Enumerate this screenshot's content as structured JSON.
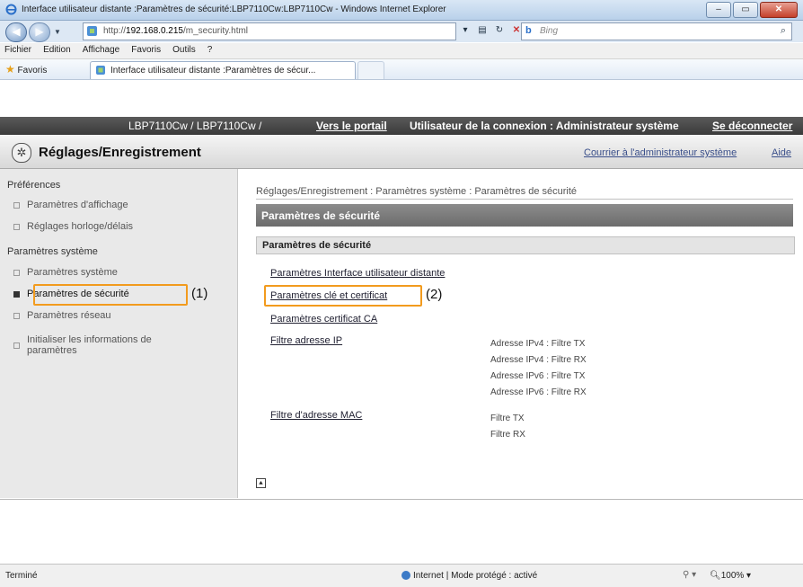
{
  "window": {
    "title": "Interface utilisateur distante :Paramètres de sécurité:LBP7110Cw:LBP7110Cw - Windows Internet Explorer",
    "minimize": "–",
    "maximize": "▭",
    "close": "✕"
  },
  "address_bar": {
    "url_prefix": "http://",
    "url_host": "192.168.0.215",
    "url_path": "/m_security.html",
    "search_placeholder": "Bing",
    "back": "◀",
    "forward": "▶"
  },
  "menu": [
    "Fichier",
    "Edition",
    "Affichage",
    "Favoris",
    "Outils",
    "?"
  ],
  "favorites_bar": {
    "favorites_label": "Favoris",
    "tab_title": "Interface utilisateur distante :Paramètres de sécur..."
  },
  "header": {
    "device": "LBP7110Cw / LBP7110Cw /",
    "portal_link": "Vers le portail",
    "login_user": "Utilisateur de la connexion : Administrateur système",
    "logout_link": "Se déconnecter",
    "page_title": "Réglages/Enregistrement",
    "mail_link": "Courrier à l'administrateur système",
    "help_link": "Aide"
  },
  "sidebar": {
    "section_preferences": "Préférences",
    "preferences_items": [
      "Paramètres d'affichage",
      "Réglages horloge/délais"
    ],
    "section_system": "Paramètres système",
    "system_items": [
      "Paramètres système",
      "Paramètres de sécurité",
      "Paramètres réseau"
    ],
    "init_item_line1": "Initialiser les informations de",
    "init_item_line2": "paramètres"
  },
  "callouts": {
    "one": "(1)",
    "two": "(2)"
  },
  "main": {
    "breadcrumb": "Réglages/Enregistrement : Paramètres système : Paramètres de sécurité",
    "section_title": "Paramètres de sécurité",
    "subsection_title": "Paramètres de sécurité",
    "links": {
      "remote_ui": "Paramètres Interface utilisateur distante",
      "key_cert": "Paramètres clé et certificat",
      "ca_cert": "Paramètres certificat CA",
      "ip_filter": "Filtre adresse IP",
      "mac_filter": "Filtre d'adresse MAC"
    },
    "ip_filter_info": [
      "Adresse IPv4 : Filtre TX",
      "Adresse IPv4 : Filtre RX",
      "Adresse IPv6 : Filtre TX",
      "Adresse IPv6 : Filtre RX"
    ],
    "mac_filter_info": [
      "Filtre TX",
      "Filtre RX"
    ]
  },
  "status_bar": {
    "status": "Terminé",
    "zone": "Internet | Mode protégé : activé",
    "zoom": "100%"
  },
  "colors": {
    "highlight": "#f29b1e",
    "header_dark": "#3a3a3a"
  }
}
